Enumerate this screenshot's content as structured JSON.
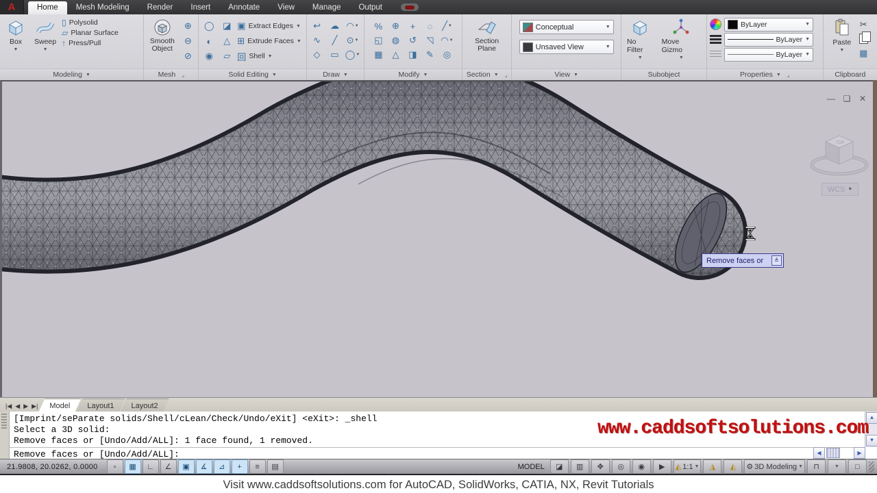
{
  "app": {
    "logo_letter": "A"
  },
  "ribbon_tabs": [
    {
      "label": "Home",
      "active": true
    },
    {
      "label": "Mesh Modeling",
      "active": false
    },
    {
      "label": "Render",
      "active": false
    },
    {
      "label": "Insert",
      "active": false
    },
    {
      "label": "Annotate",
      "active": false
    },
    {
      "label": "View",
      "active": false
    },
    {
      "label": "Manage",
      "active": false
    },
    {
      "label": "Output",
      "active": false
    }
  ],
  "ribbon": {
    "modeling": {
      "label": "Modeling",
      "box": "Box",
      "sweep": "Sweep",
      "polysolid": "Polysolid",
      "planar_surface": "Planar Surface",
      "press_pull": "Press/Pull"
    },
    "mesh": {
      "label": "Mesh",
      "smooth_object": "Smooth Object",
      "icons": [
        {
          "name": "smooth-more-icon",
          "glyph": "⊕"
        },
        {
          "name": "smooth-less-icon",
          "glyph": "⊖"
        },
        {
          "name": "refine-mesh-icon",
          "glyph": "⊘"
        }
      ]
    },
    "solid_editing": {
      "label": "Solid Editing",
      "extract_edges": "Extract Edges",
      "extrude_faces": "Extrude Faces",
      "shell": "Shell",
      "boolean_icons": [
        {
          "name": "union-icon",
          "glyph": "◯"
        },
        {
          "name": "subtract-icon",
          "glyph": "◐"
        },
        {
          "name": "intersect-icon",
          "glyph": "◉"
        }
      ],
      "edit_icons": [
        {
          "name": "slice-icon",
          "glyph": "◪"
        },
        {
          "name": "interfere-icon",
          "glyph": "△"
        },
        {
          "name": "thicken-icon",
          "glyph": "▱"
        }
      ]
    },
    "draw": {
      "label": "Draw",
      "icons": [
        {
          "name": "polyline-icon",
          "glyph": "↩"
        },
        {
          "name": "revision-cloud-icon",
          "glyph": "☁"
        },
        {
          "name": "arc-icon",
          "glyph": "◠",
          "dd": true
        },
        {
          "name": "spline-icon",
          "glyph": "∿"
        },
        {
          "name": "line-icon",
          "glyph": "╱"
        },
        {
          "name": "circle-icon",
          "glyph": "⊙",
          "dd": true
        },
        {
          "name": "polygon-icon",
          "glyph": "◇"
        },
        {
          "name": "rectangle-icon",
          "glyph": "▭"
        },
        {
          "name": "ellipse-icon",
          "glyph": "◯",
          "dd": true
        }
      ]
    },
    "modify": {
      "label": "Modify",
      "icons": [
        {
          "name": "explode-icon",
          "glyph": "%"
        },
        {
          "name": "3d-rotate-icon",
          "glyph": "⊕"
        },
        {
          "name": "3d-move-icon",
          "glyph": "+"
        },
        {
          "name": "interfere-check-icon",
          "glyph": "◌"
        },
        {
          "name": "break-icon",
          "glyph": "╱",
          "dd": true
        },
        {
          "name": "copy-icon",
          "glyph": "◱"
        },
        {
          "name": "3d-mirror-icon",
          "glyph": "◍"
        },
        {
          "name": "rotate-icon",
          "glyph": "↺"
        },
        {
          "name": "scale-icon",
          "glyph": "◹"
        },
        {
          "name": "fillet-icon",
          "glyph": "◠",
          "dd": true
        },
        {
          "name": "array-icon",
          "glyph": "▦"
        },
        {
          "name": "3d-align-icon",
          "glyph": "△"
        },
        {
          "name": "stretch-icon",
          "glyph": "◨"
        },
        {
          "name": "erase-icon",
          "glyph": "✎"
        },
        {
          "name": "offset-icon",
          "glyph": "◎"
        }
      ]
    },
    "section": {
      "label": "Section",
      "section_plane": "Section Plane"
    },
    "view": {
      "label": "View",
      "visual_style": "Conceptual",
      "saved_view": "Unsaved View"
    },
    "subobject": {
      "label": "Subobject",
      "no_filter": "No Filter",
      "move_gizmo": "Move Gizmo"
    },
    "properties": {
      "label": "Properties",
      "object_color": "ByLayer",
      "lineweight": "ByLayer",
      "linetype": "ByLayer"
    },
    "clipboard": {
      "label": "Clipboard",
      "paste": "Paste"
    }
  },
  "canvas": {
    "viewcube": {
      "top_face": "TOP",
      "wcs": "WCS"
    },
    "tooltip": "Remove faces or",
    "window_controls": {
      "minimize": "—",
      "restore": "❏",
      "close": "✕"
    }
  },
  "layout_bar": {
    "nav": [
      "|◀",
      "◀",
      "▶",
      "▶|"
    ],
    "tabs": [
      {
        "label": "Model",
        "active": true
      },
      {
        "label": "Layout1",
        "active": false
      },
      {
        "label": "Layout2",
        "active": false
      }
    ]
  },
  "command": {
    "history": [
      "[Imprint/seParate solids/Shell/cLean/Check/Undo/eXit] <eXit>: _shell",
      "Select a 3D solid:",
      "Remove faces or [Undo/Add/ALL]: 1 face found, 1 removed."
    ],
    "prompt": "Remove faces or [Undo/Add/ALL]:"
  },
  "watermark": "www.caddsoftsolutions.com",
  "status": {
    "coordinates": "21.9808, 20.0262, 0.0000",
    "toggles": [
      {
        "name": "snap-toggle",
        "glyph": "▫",
        "active": false
      },
      {
        "name": "grid-toggle",
        "glyph": "▦",
        "active": true
      },
      {
        "name": "ortho-toggle",
        "glyph": "∟",
        "active": false
      },
      {
        "name": "polar-toggle",
        "glyph": "∠",
        "active": false
      },
      {
        "name": "osnap-toggle",
        "glyph": "▣",
        "active": true
      },
      {
        "name": "otrack-toggle",
        "glyph": "∡",
        "active": true
      },
      {
        "name": "ducs-toggle",
        "glyph": "⊿",
        "active": true
      },
      {
        "name": "dyn-toggle",
        "glyph": "+",
        "active": true
      },
      {
        "name": "lwt-toggle",
        "glyph": "≡",
        "active": false
      },
      {
        "name": "qp-toggle",
        "glyph": "▤",
        "active": false
      }
    ],
    "model_label": "MODEL",
    "annotation_scale": "1:1",
    "workspace": "3D Modeling"
  },
  "footer": "Visit www.caddsoftsolutions.com for AutoCAD, SolidWorks, CATIA, NX, Revit Tutorials"
}
